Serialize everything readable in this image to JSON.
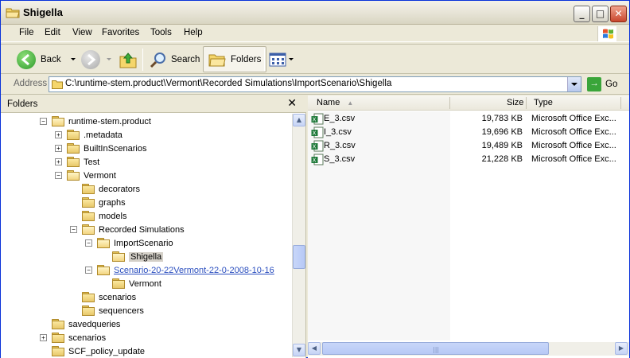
{
  "window": {
    "title": "Shigella"
  },
  "menu": {
    "items": [
      {
        "label": "File"
      },
      {
        "label": "Edit"
      },
      {
        "label": "View"
      },
      {
        "label": "Favorites"
      },
      {
        "label": "Tools"
      },
      {
        "label": "Help"
      }
    ]
  },
  "toolbar": {
    "back_label": "Back",
    "search_label": "Search",
    "folders_label": "Folders"
  },
  "address": {
    "label": "Address",
    "value": "C:\\runtime-stem.product\\Vermont\\Recorded Simulations\\ImportScenario\\Shigella",
    "go_label": "Go"
  },
  "folders_pane": {
    "title": "Folders",
    "close_glyph": "✕",
    "tree": [
      {
        "label": "runtime-stem.product",
        "expander": "−"
      },
      {
        "label": ".metadata",
        "expander": "+"
      },
      {
        "label": "BuiltInScenarios",
        "expander": "+"
      },
      {
        "label": "Test",
        "expander": "+"
      },
      {
        "label": "Vermont",
        "expander": "−"
      },
      {
        "label": "decorators",
        "expander": ""
      },
      {
        "label": "graphs",
        "expander": ""
      },
      {
        "label": "models",
        "expander": ""
      },
      {
        "label": "Recorded Simulations",
        "expander": "−"
      },
      {
        "label": "ImportScenario",
        "expander": "−"
      },
      {
        "label": "Shigella",
        "expander": ""
      },
      {
        "label": "Scenario-20-22Vermont-22-0-2008-10-16",
        "expander": "−"
      },
      {
        "label": "Vermont",
        "expander": ""
      },
      {
        "label": "scenarios",
        "expander": ""
      },
      {
        "label": "sequencers",
        "expander": ""
      },
      {
        "label": "savedqueries",
        "expander": ""
      },
      {
        "label": "scenarios",
        "expander": "+"
      },
      {
        "label": "SCF_policy_update",
        "expander": ""
      }
    ]
  },
  "file_list": {
    "columns": {
      "name": "Name",
      "size": "Size",
      "type": "Type"
    },
    "rows": [
      {
        "name": "E_3.csv",
        "size": "19,783 KB",
        "type": "Microsoft Office Exc..."
      },
      {
        "name": "I_3.csv",
        "size": "19,696 KB",
        "type": "Microsoft Office Exc..."
      },
      {
        "name": "R_3.csv",
        "size": "19,489 KB",
        "type": "Microsoft Office Exc..."
      },
      {
        "name": "S_3.csv",
        "size": "21,228 KB",
        "type": "Microsoft Office Exc..."
      }
    ]
  },
  "colors": {
    "title_bar": "#ece9d8",
    "window_border": "#0831d9",
    "link": "#2b4fbf",
    "excel_green": "#1f7a3a"
  }
}
